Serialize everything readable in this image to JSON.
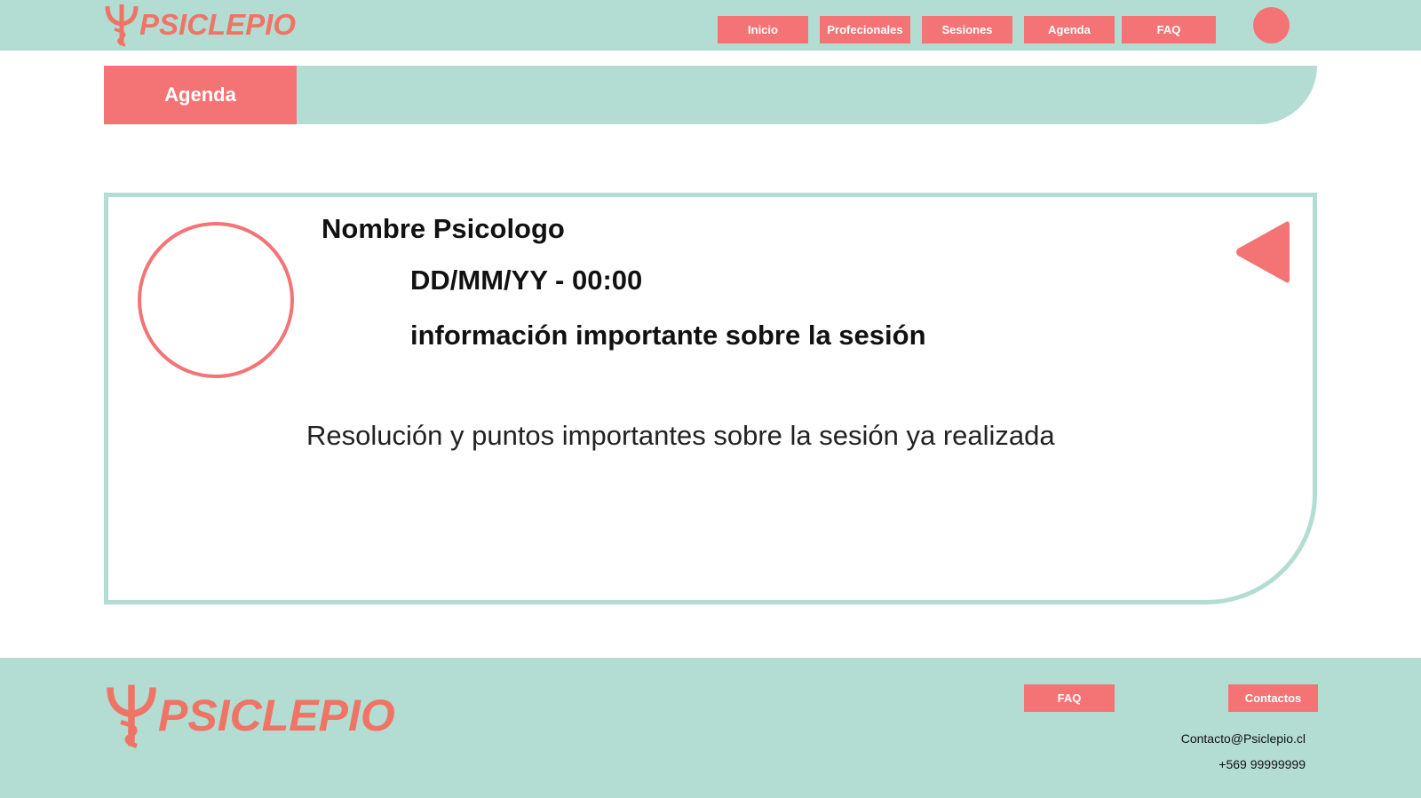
{
  "brand": {
    "name": "PSICLEPIO",
    "color": "#f07466"
  },
  "nav": {
    "items": [
      {
        "label": "Inicio"
      },
      {
        "label": "Profecionales"
      },
      {
        "label": "Sesiones"
      },
      {
        "label": "Agenda"
      },
      {
        "label": "FAQ"
      }
    ]
  },
  "section": {
    "title": "Agenda"
  },
  "session": {
    "psychologist_name": "Nombre Psicologo",
    "datetime": "DD/MM/YY - 00:00",
    "important_info": "información importante sobre la sesión",
    "notes": "Resolución y puntos importantes sobre la sesión ya realizada"
  },
  "footer": {
    "faq_label": "FAQ",
    "contacts_label": "Contactos",
    "email": "Contacto@Psiclepio.cl",
    "phone": "+569 99999999"
  },
  "icons": {
    "logo": "psi-staff-logo-icon",
    "user": "user-avatar-icon",
    "back": "triangle-back-icon"
  },
  "colors": {
    "teal": "#b3ddd2",
    "coral": "#f47476",
    "text": "#111111"
  }
}
